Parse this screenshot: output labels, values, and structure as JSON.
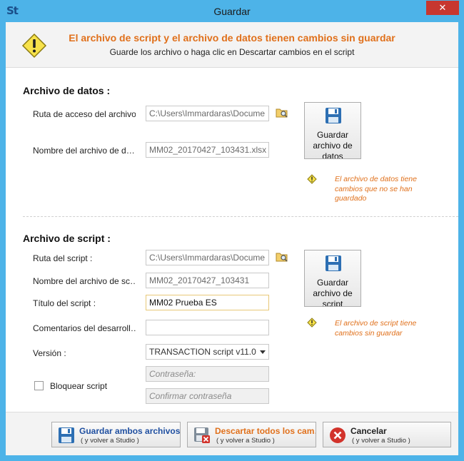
{
  "window": {
    "app_logo": "St",
    "title": "Guardar",
    "close_glyph": "✕"
  },
  "header": {
    "title": "El archivo de script y el archivo de datos tienen cambios sin guardar",
    "subtitle": "Guarde los archivo o haga clic en Descartar cambios en el script",
    "icon": "warning-icon"
  },
  "data_section": {
    "title": "Archivo de datos :",
    "path_label": "Ruta de acceso del archivo…",
    "path_value": "C:\\Users\\Immardaras\\Docume",
    "name_label": "Nombre del archivo de d…",
    "name_value": "MM02_20170427_103431.xlsx",
    "save_button": "Guardar archivo de datos",
    "note": "El archivo de datos tiene cambios que no se han guardado"
  },
  "script_section": {
    "title": "Archivo de script :",
    "path_label": "Ruta del script :",
    "path_value": "C:\\Users\\Immardaras\\Docume",
    "name_label": "Nombre del archivo de sc…",
    "name_value": "MM02_20170427_103431",
    "title_label": "Título del script :",
    "title_value": "MM02 Prueba ES",
    "comments_label": "Comentarios del desarroll…",
    "comments_value": "",
    "version_label": "Versión :",
    "version_value": "TRANSACTION script v11.0",
    "lock_label": "Bloquear script",
    "lock_checked": false,
    "password_placeholder": "Contraseña:",
    "confirm_placeholder": "Confirmar contraseña",
    "save_button": "Guardar archivo de script",
    "note": "El archivo de script tiene cambios sin guardar"
  },
  "footer": {
    "save_both": {
      "label": "Guardar ambos archivos",
      "sub": "( y volver a Studio )"
    },
    "discard": {
      "label": "Descartar todos los cam…",
      "sub": "( y volver a Studio )"
    },
    "cancel": {
      "label": "Cancelar",
      "sub": "( y volver a Studio )"
    }
  },
  "colors": {
    "accent_orange": "#e0701b",
    "accent_blue": "#1f4fa0",
    "window_frame": "#4db3e8",
    "close_red": "#c7372f"
  }
}
